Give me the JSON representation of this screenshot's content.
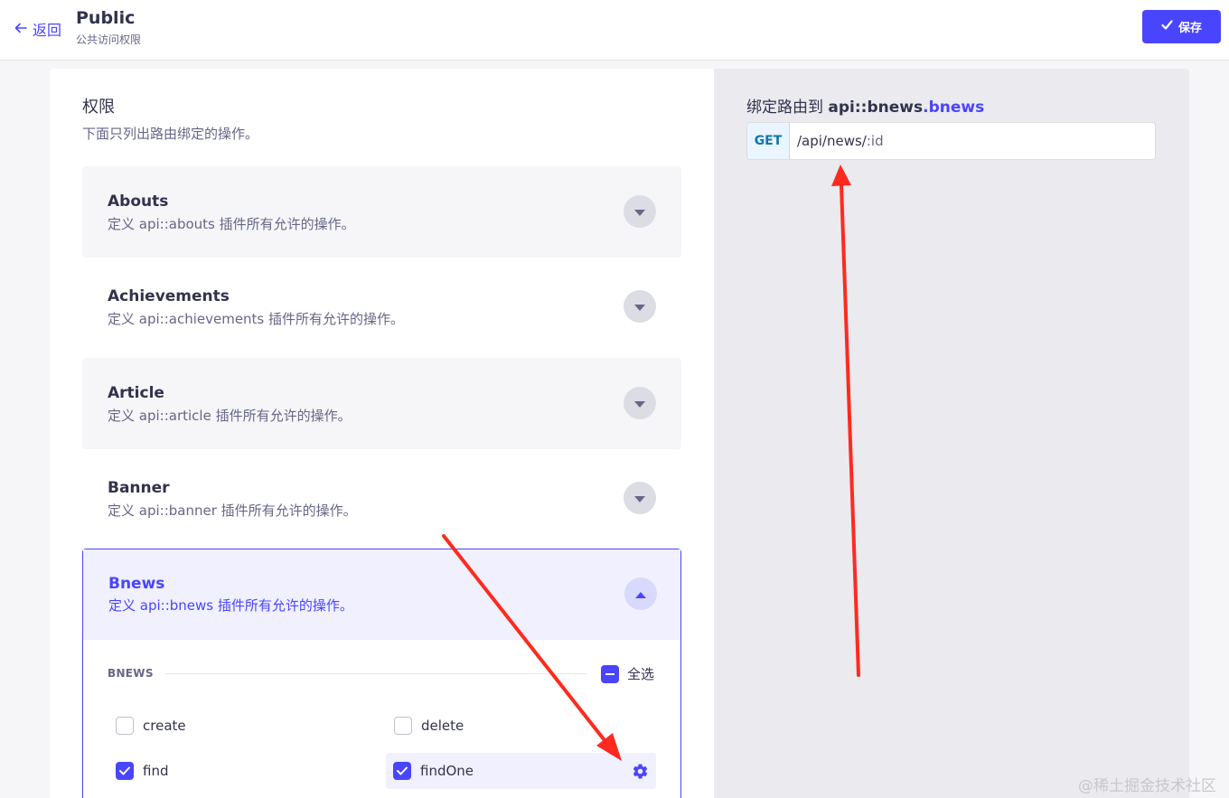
{
  "header": {
    "back_label": "返回",
    "title": "Public",
    "subtitle": "公共访问权限",
    "save_label": "保存"
  },
  "permissions": {
    "title": "权限",
    "description": "下面只列出路由绑定的操作。",
    "groups": [
      {
        "title": "Abouts",
        "description": "定义 api::abouts 插件所有允许的操作。",
        "expanded": false
      },
      {
        "title": "Achievements",
        "description": "定义 api::achievements 插件所有允许的操作。",
        "expanded": false
      },
      {
        "title": "Article",
        "description": "定义 api::article 插件所有允许的操作。",
        "expanded": false
      },
      {
        "title": "Banner",
        "description": "定义 api::banner 插件所有允许的操作。",
        "expanded": false
      },
      {
        "title": "Bnews",
        "description": "定义 api::bnews 插件所有允许的操作。",
        "expanded": true
      }
    ],
    "open_section": {
      "label": "BNEWS",
      "select_all_label": "全选",
      "actions": [
        {
          "label": "create",
          "checked": false
        },
        {
          "label": "delete",
          "checked": false
        },
        {
          "label": "find",
          "checked": true
        },
        {
          "label": "findOne",
          "checked": true,
          "active": true
        }
      ]
    }
  },
  "binding": {
    "prefix": "绑定路由到 ",
    "api": "api::bnews",
    "dot_name": ".bnews",
    "method": "GET",
    "path_base": "/api/news/",
    "path_param": ":id"
  },
  "watermark": "@稀土掘金技术社区",
  "colors": {
    "primary": "#4945ff",
    "annotation_arrow": "#ff2a1f"
  }
}
